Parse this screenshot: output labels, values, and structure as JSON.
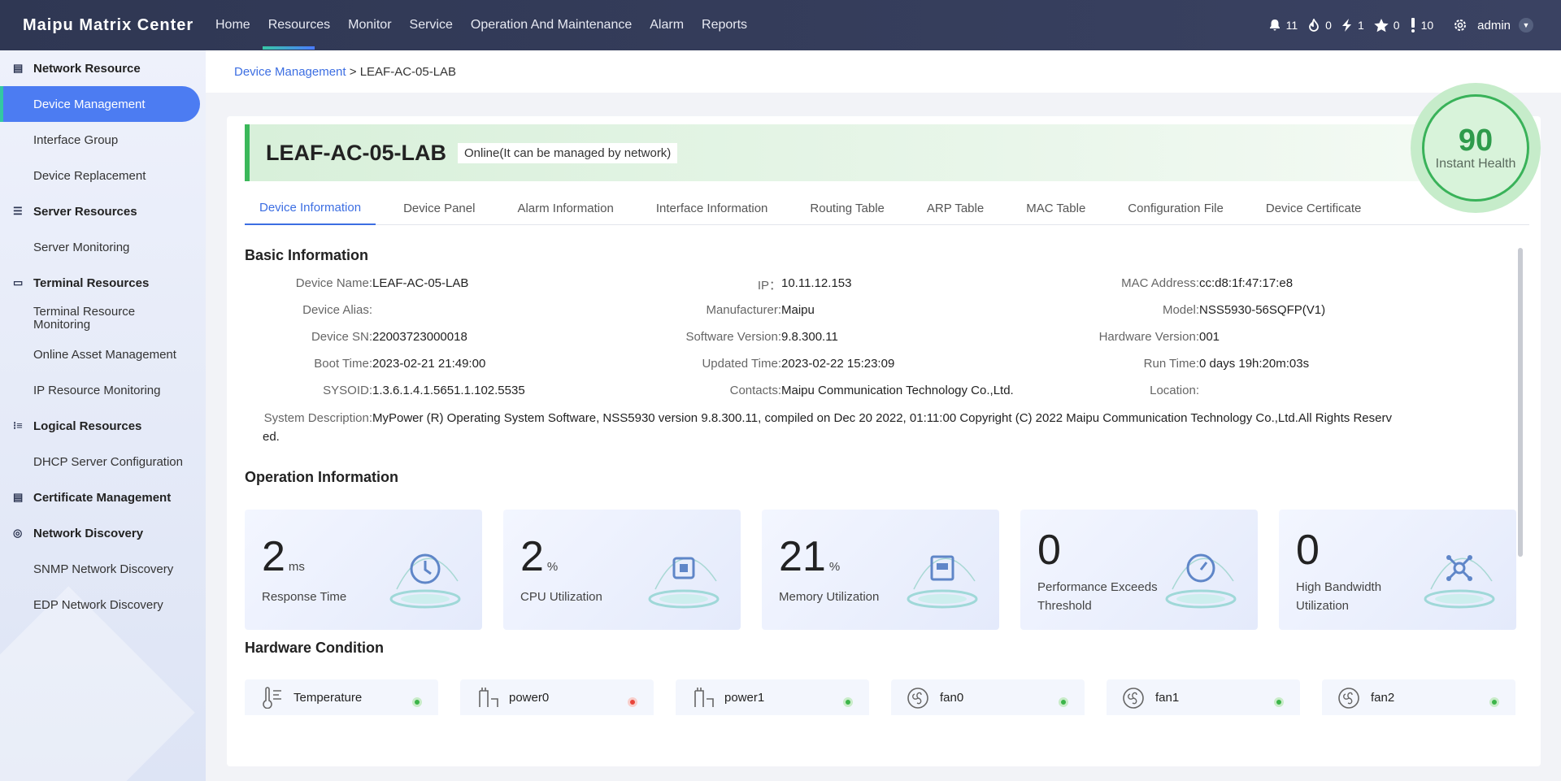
{
  "app": {
    "title": "Maipu Matrix Center"
  },
  "nav": [
    "Home",
    "Resources",
    "Monitor",
    "Service",
    "Operation And Maintenance",
    "Alarm",
    "Reports"
  ],
  "status": {
    "bell": "11",
    "fire": "0",
    "bolt": "1",
    "star": "0",
    "excl": "10",
    "user": "admin"
  },
  "sidebar": {
    "g1": "Network Resource",
    "i_device": "Device Management",
    "i_iface": "Interface Group",
    "i_repl": "Device Replacement",
    "g2": "Server Resources",
    "i_srv": "Server Monitoring",
    "g3": "Terminal Resources",
    "i_trm": "Terminal Resource Monitoring",
    "i_asset": "Online Asset Management",
    "i_ip": "IP Resource Monitoring",
    "g4": "Logical Resources",
    "i_dhcp": "DHCP Server Configuration",
    "g5": "Certificate Management",
    "g6": "Network Discovery",
    "i_snmp": "SNMP Network Discovery",
    "i_edp": "EDP Network Discovery"
  },
  "breadcrumb": {
    "parent": "Device Management",
    "sep": " > ",
    "current": "LEAF-AC-05-LAB"
  },
  "device": {
    "name": "LEAF-AC-05-LAB",
    "status": "Online(It can be managed by network)"
  },
  "health": {
    "value": "90",
    "label": "Instant Health"
  },
  "tabs": [
    "Device Information",
    "Device Panel",
    "Alarm Information",
    "Interface Information",
    "Routing Table",
    "ARP Table",
    "MAC Table",
    "Configuration File",
    "Device Certificate"
  ],
  "basic": {
    "title": "Basic Information",
    "name_l": "Device Name:",
    "name_v": "LEAF-AC-05-LAB",
    "ip_l": "IP：",
    "ip_v": "10.11.12.153",
    "mac_l": "MAC Address:",
    "mac_v": "cc:d8:1f:47:17:e8",
    "alias_l": "Device Alias:",
    "alias_v": "",
    "mfr_l": "Manufacturer:",
    "mfr_v": "Maipu",
    "model_l": "Model:",
    "model_v": "NSS5930-56SQFP(V1)",
    "sn_l": "Device SN:",
    "sn_v": "22003723000018",
    "sw_l": "Software Version:",
    "sw_v": "9.8.300.11",
    "hw_l": "Hardware Version:",
    "hw_v": "001",
    "boot_l": "Boot Time:",
    "boot_v": "2023-02-21 21:49:00",
    "upd_l": "Updated Time:",
    "upd_v": "2023-02-22 15:23:09",
    "run_l": "Run Time:",
    "run_v": "0 days 19h:20m:03s",
    "sysoid_l": "SYSOID:",
    "sysoid_v": "1.3.6.1.4.1.5651.1.102.5535",
    "contact_l": "Contacts:",
    "contact_v": "Maipu Communication Technology Co.,Ltd.",
    "loc_l": "Location:",
    "loc_v": "",
    "desc_l": "System Description:",
    "desc_v": "MyPower (R) Operating System Software, NSS5930 version 9.8.300.11, compiled on Dec 20 2022, 01:11:00 Copyright (C) 2022 Maipu Communication Technology Co.,Ltd.All Rights Reserv",
    "desc_v2": "ed."
  },
  "operation": {
    "title": "Operation Information",
    "m1": {
      "value": "2",
      "unit": "ms",
      "label": "Response Time"
    },
    "m2": {
      "value": "2",
      "unit": "%",
      "label": "CPU Utilization"
    },
    "m3": {
      "value": "21",
      "unit": "%",
      "label": "Memory Utilization"
    },
    "m4": {
      "value": "0",
      "label1": "Performance Exceeds",
      "label2": "Threshold"
    },
    "m5": {
      "value": "0",
      "label1": "High Bandwidth",
      "label2": "Utilization"
    }
  },
  "hardware": {
    "title": "Hardware Condition",
    "items": [
      {
        "name": "Temperature",
        "color": "#3cb54a"
      },
      {
        "name": "power0",
        "color": "#e8443a"
      },
      {
        "name": "power1",
        "color": "#3cb54a"
      },
      {
        "name": "fan0",
        "color": "#3cb54a"
      },
      {
        "name": "fan1",
        "color": "#3cb54a"
      },
      {
        "name": "fan2",
        "color": "#3cb54a"
      }
    ]
  }
}
